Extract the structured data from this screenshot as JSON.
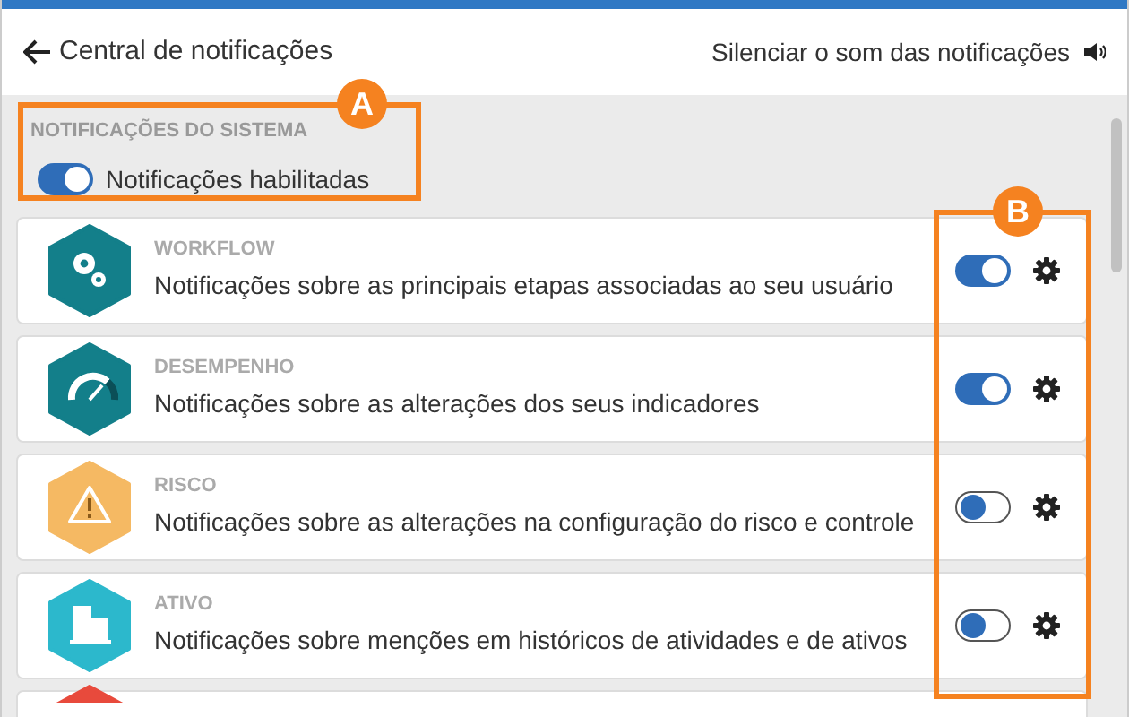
{
  "header": {
    "back_label": "Central de notificações",
    "mute_label": "Silenciar o som das notificações"
  },
  "system": {
    "title": "NOTIFICAÇÕES DO SISTEMA",
    "toggle_label": "Notificações habilitadas",
    "on": true
  },
  "items": [
    {
      "kind": "gears",
      "color": "#137f8a",
      "category": "WORKFLOW",
      "description": "Notificações sobre as principais etapas associadas ao seu usuário",
      "on": true
    },
    {
      "kind": "gauge",
      "color": "#137f8a",
      "category": "DESEMPENHO",
      "description": "Notificações sobre as alterações dos seus indicadores",
      "on": true
    },
    {
      "kind": "warning",
      "color": "#f5b963",
      "category": "RISCO",
      "description": "Notificações sobre as alterações na configuração do risco e controle",
      "on": false
    },
    {
      "kind": "building",
      "color": "#2cb8cc",
      "category": "ATIVO",
      "description": "Notificações sobre menções em históricos de atividades e de ativos",
      "on": false
    },
    {
      "kind": "partial",
      "color": "#e84a3c"
    }
  ],
  "annotations": [
    {
      "label": "A"
    },
    {
      "label": "B"
    }
  ]
}
